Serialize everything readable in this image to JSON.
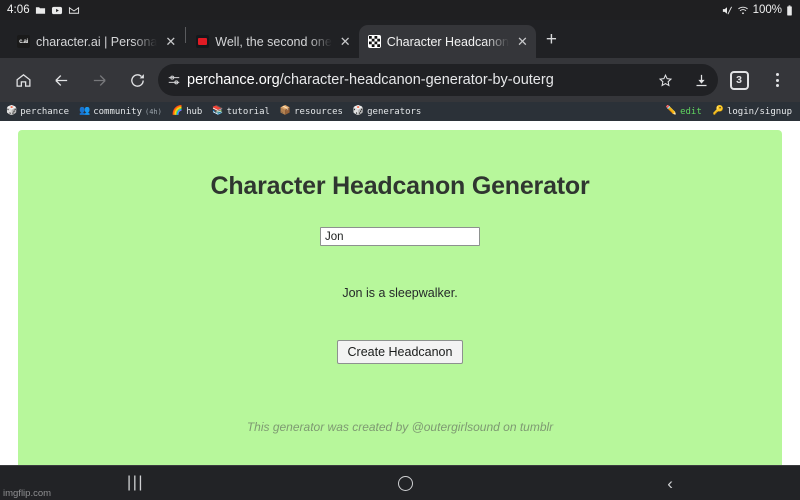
{
  "status_bar": {
    "clock": "4:06",
    "battery_text": "100%",
    "left_icons": [
      "folder-icon",
      "youtube-icon",
      "gmail-icon"
    ],
    "right_icons": [
      "mute-icon",
      "wifi-icon",
      "battery-icon"
    ]
  },
  "browser": {
    "tabs": [
      {
        "title": "character.ai | Persona",
        "favicon": "character-ai-favicon",
        "active": false
      },
      {
        "title": "Well, the second one",
        "favicon": "red-page-favicon",
        "active": false
      },
      {
        "title": "Character Headcanon",
        "favicon": "perchance-dice-favicon",
        "active": true
      }
    ],
    "new_tab_label": "+",
    "close_label": "✕",
    "toolbar": {
      "home_icon": "home-icon",
      "back_icon": "back-arrow-icon",
      "forward_icon": "forward-arrow-icon",
      "reload_icon": "reload-icon",
      "site_info_icon": "tune-lock-icon",
      "url_domain": "perchance.org",
      "url_path": "/character-headcanon-generator-by-outerg",
      "bookmark_icon": "star-icon",
      "download_icon": "download-icon",
      "tab_count": "3",
      "menu_icon": "three-dots-menu-icon"
    }
  },
  "perchance_nav": {
    "left_items": [
      {
        "label": "perchance",
        "icon": "dice-logo-icon",
        "sub": ""
      },
      {
        "label": "community",
        "icon": "people-icon",
        "sub": "(4h)"
      },
      {
        "label": "hub",
        "icon": "rainbow-icon",
        "sub": ""
      },
      {
        "label": "tutorial",
        "icon": "books-icon",
        "sub": ""
      },
      {
        "label": "resources",
        "icon": "package-icon",
        "sub": ""
      },
      {
        "label": "generators",
        "icon": "globe-dice-icon",
        "sub": ""
      }
    ],
    "edit_label": "edit",
    "edit_icon": "pencil-icon",
    "login_label": "login/signup",
    "login_icon": "key-icon"
  },
  "generator": {
    "title": "Character Headcanon Generator",
    "name_input_value": "Jon",
    "name_input_placeholder": "",
    "result_text": "Jon is a sleepwalker.",
    "button_label": "Create Headcanon",
    "credit": "This generator was created by @outergirlsound on tumblr",
    "panel_color": "#b7f79b"
  },
  "android_nav": {
    "recents_label": "|||",
    "home_icon": "home-circle-icon",
    "back_label": "‹"
  },
  "watermark": "imgflip.com"
}
